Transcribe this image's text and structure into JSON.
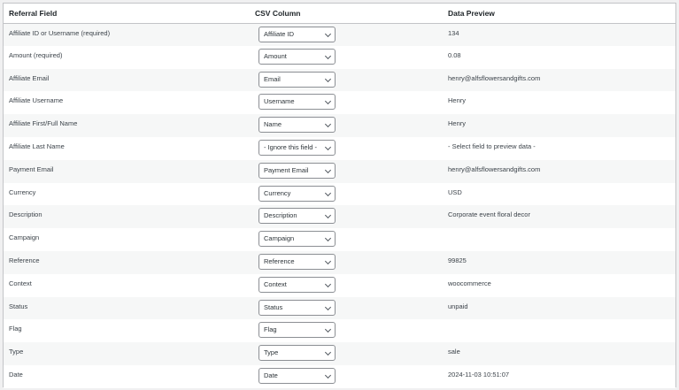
{
  "headers": {
    "field": "Referral Field",
    "column": "CSV Column",
    "preview": "Data Preview"
  },
  "rows": [
    {
      "field": "Affiliate ID or Username (required)",
      "column": "Affiliate ID",
      "preview": "134"
    },
    {
      "field": "Amount (required)",
      "column": "Amount",
      "preview": "0.08"
    },
    {
      "field": "Affiliate Email",
      "column": "Email",
      "preview": "henry@alfsflowersandgifts.com"
    },
    {
      "field": "Affiliate Username",
      "column": "Username",
      "preview": "Henry"
    },
    {
      "field": "Affiliate First/Full Name",
      "column": "Name",
      "preview": "Henry"
    },
    {
      "field": "Affiliate Last Name",
      "column": "- Ignore this field -",
      "preview": "- Select field to preview data -"
    },
    {
      "field": "Payment Email",
      "column": "Payment Email",
      "preview": "henry@alfsflowersandgifts.com"
    },
    {
      "field": "Currency",
      "column": "Currency",
      "preview": "USD"
    },
    {
      "field": "Description",
      "column": "Description",
      "preview": "Corporate event floral decor"
    },
    {
      "field": "Campaign",
      "column": "Campaign",
      "preview": ""
    },
    {
      "field": "Reference",
      "column": "Reference",
      "preview": "99825"
    },
    {
      "field": "Context",
      "column": "Context",
      "preview": "woocommerce"
    },
    {
      "field": "Status",
      "column": "Status",
      "preview": "unpaid"
    },
    {
      "field": "Flag",
      "column": "Flag",
      "preview": ""
    },
    {
      "field": "Type",
      "column": "Type",
      "preview": "sale"
    },
    {
      "field": "Date",
      "column": "Date",
      "preview": "2024-11-03 10:51:07"
    }
  ]
}
